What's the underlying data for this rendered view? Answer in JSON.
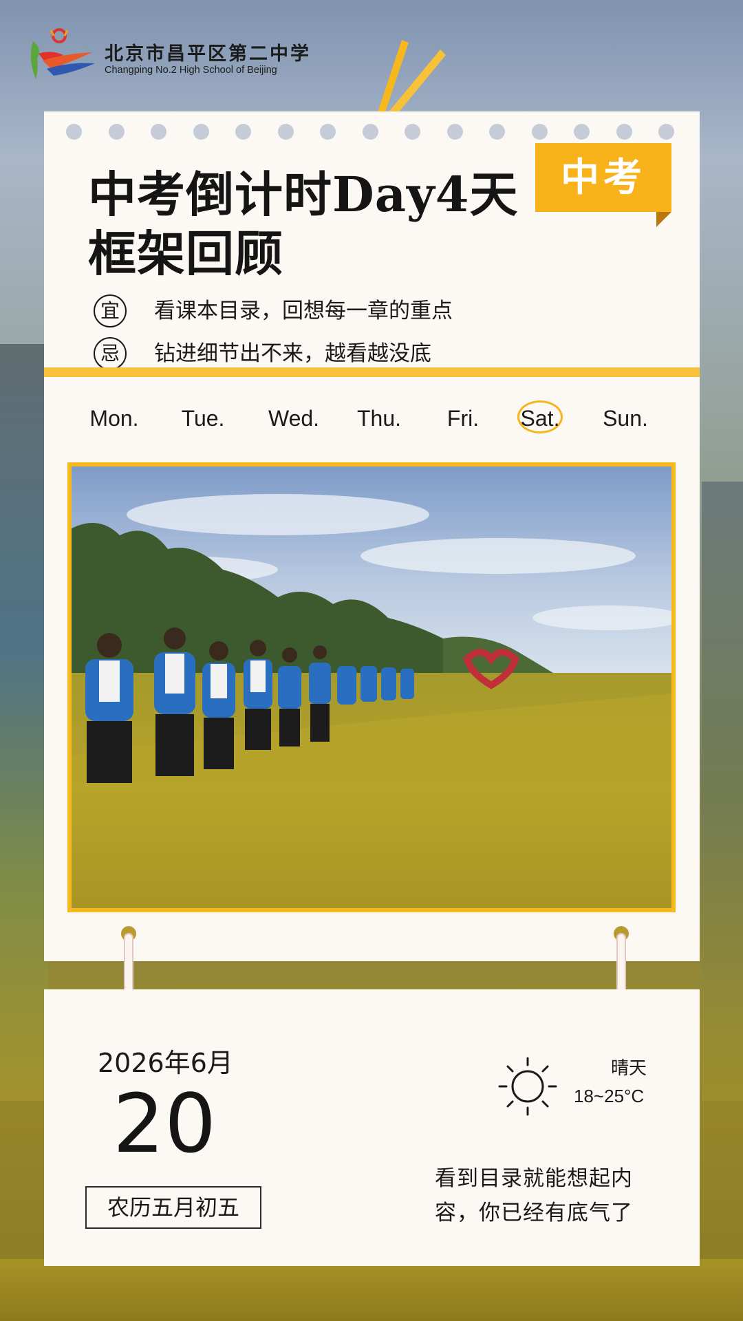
{
  "school": {
    "name_cn": "北京市昌平区第二中学",
    "name_en": "Changping No.2 High School of Beijing",
    "logo_icon": "school-logo-icon"
  },
  "header": {
    "title_line1": "中考倒计时Day4天",
    "title_line2": "框架回顾",
    "tag": "中考"
  },
  "advice": {
    "yi_mark": "宜",
    "yi_text": "看课本目录，回想每一章的重点",
    "ji_mark": "忌",
    "ji_text": "钻进细节出不来，越看越没底"
  },
  "weekdays": [
    "Mon.",
    "Tue.",
    "Wed.",
    "Thu.",
    "Fri.",
    "Sat.",
    "Sun."
  ],
  "selected_weekday": "Sat.",
  "photo": {
    "icon": "students-rice-field-photo"
  },
  "date": {
    "year_month": "2026年6月",
    "day": "20",
    "lunar": "农历五月初五"
  },
  "weather": {
    "icon": "sun-icon",
    "condition": "晴天",
    "temperature": "18~25°C"
  },
  "note": "看到目录就能想起内容，你已经有底气了",
  "colors": {
    "accent": "#f8b21a",
    "card": "#fcf8f4",
    "hole": "#c6ccd7",
    "text": "#1a1a1a"
  }
}
